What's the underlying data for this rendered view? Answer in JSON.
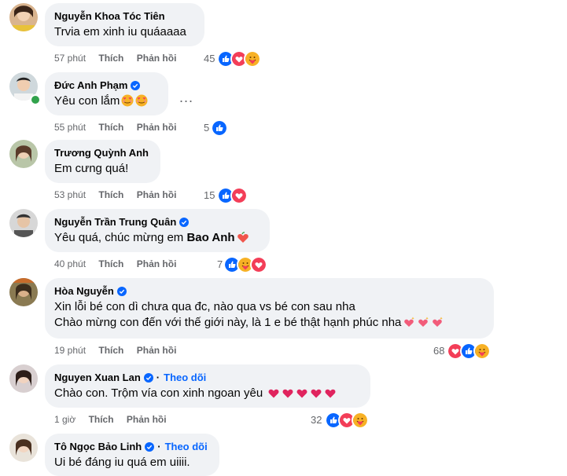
{
  "comments": [
    {
      "name": "Nguyễn Khoa Tóc Tiên",
      "text": "Trvia em xinh iu quáaaaa",
      "time": "57 phút",
      "like": "Thích",
      "reply": "Phản hồi",
      "reactions": "45",
      "verified": false
    },
    {
      "name": "Đức Anh Phạm",
      "text": "Yêu con lắm",
      "time": "55 phút",
      "like": "Thích",
      "reply": "Phản hồi",
      "reactions": "5",
      "verified": true,
      "more": "..."
    },
    {
      "name": "Trương Quỳnh Anh",
      "text": "Em cưng quá!",
      "time": "53 phút",
      "like": "Thích",
      "reply": "Phản hồi",
      "reactions": "15",
      "verified": false
    },
    {
      "name": "Nguyễn Trần Trung Quân",
      "text": "Yêu quá, chúc mừng em ",
      "mention": "Bao Anh",
      "time": "40 phút",
      "like": "Thích",
      "reply": "Phản hồi",
      "reactions": "7",
      "verified": true
    },
    {
      "name": "Hòa Nguyễn",
      "text_line1": "Xin lỗi bé con dì chưa qua đc, nào qua vs bé con sau nha",
      "text_line2": "Chào mừng con đến với thế giới này, là 1 e bé thật hạnh phúc nha",
      "time": "19 phút",
      "like": "Thích",
      "reply": "Phản hồi",
      "reactions": "68",
      "verified": true
    },
    {
      "name": "Nguyen Xuan Lan",
      "follow": "Theo dõi",
      "text": "Chào con. Trộm vía con xinh ngoan yêu",
      "time": "1 giờ",
      "like": "Thích",
      "reply": "Phản hồi",
      "reactions": "32",
      "verified": true
    },
    {
      "name": "Tô Ngọc Bảo Linh",
      "follow": "Theo dõi",
      "text": "Ui bé đáng iu quá em uiiii.",
      "verified": true
    }
  ],
  "separator": "·",
  "colors": {
    "like": "#0866ff",
    "love": "#f33e58",
    "care": "#f7b125",
    "link": "#0866ff",
    "meta": "#65676b",
    "bubble": "#f0f2f5"
  },
  "icons": [
    "like-reaction-icon",
    "love-reaction-icon",
    "care-reaction-icon",
    "verified-badge-icon",
    "heart-face-emoji-icon",
    "peach-heart-emoji-icon",
    "sparkling-hearts-emoji-icon",
    "red-heart-emoji-icon"
  ]
}
